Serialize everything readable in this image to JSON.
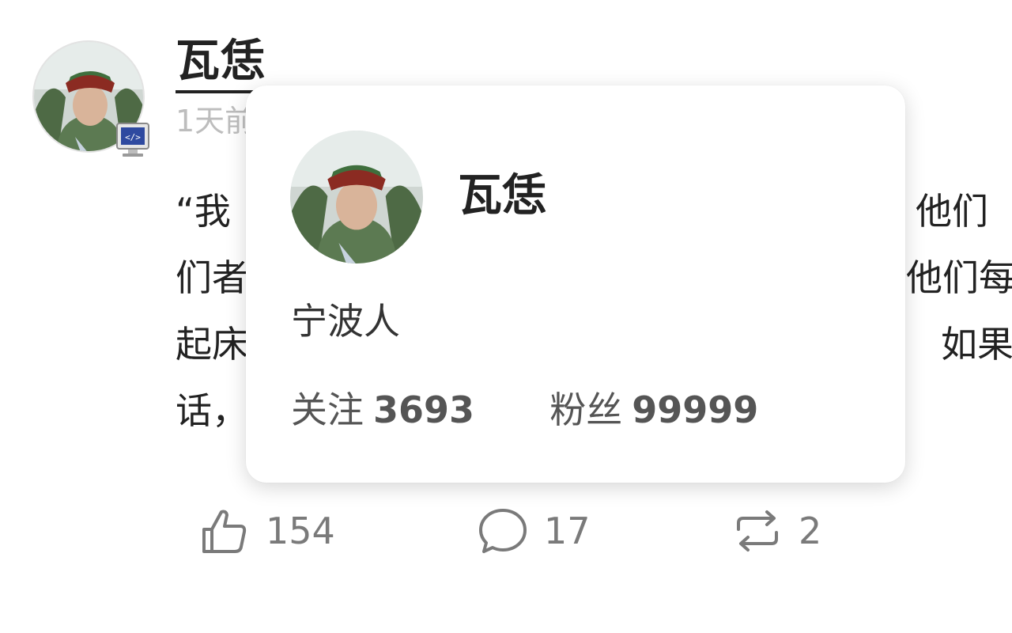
{
  "post": {
    "author": "瓦恁",
    "time": "1天前",
    "lines": [
      "“我",
      "们者",
      "起床",
      "话，"
    ],
    "right_lines": [
      "他们",
      "他们每",
      "如果",
      ""
    ]
  },
  "actions": {
    "likes": "154",
    "comments": "17",
    "reposts": "2"
  },
  "hover_card": {
    "name": "瓦恁",
    "bio": "宁波人",
    "following_label": "关注",
    "following_count": "3693",
    "followers_label": "粉丝",
    "followers_count": "99999"
  },
  "icons": {
    "badge": "developer-monitor-icon",
    "like": "thumbs-up-icon",
    "comment": "comment-bubble-icon",
    "repost": "repost-icon"
  },
  "colors": {
    "icon_gray": "#7a7a7a",
    "time_gray": "#bdbdbd",
    "text": "#222222"
  }
}
